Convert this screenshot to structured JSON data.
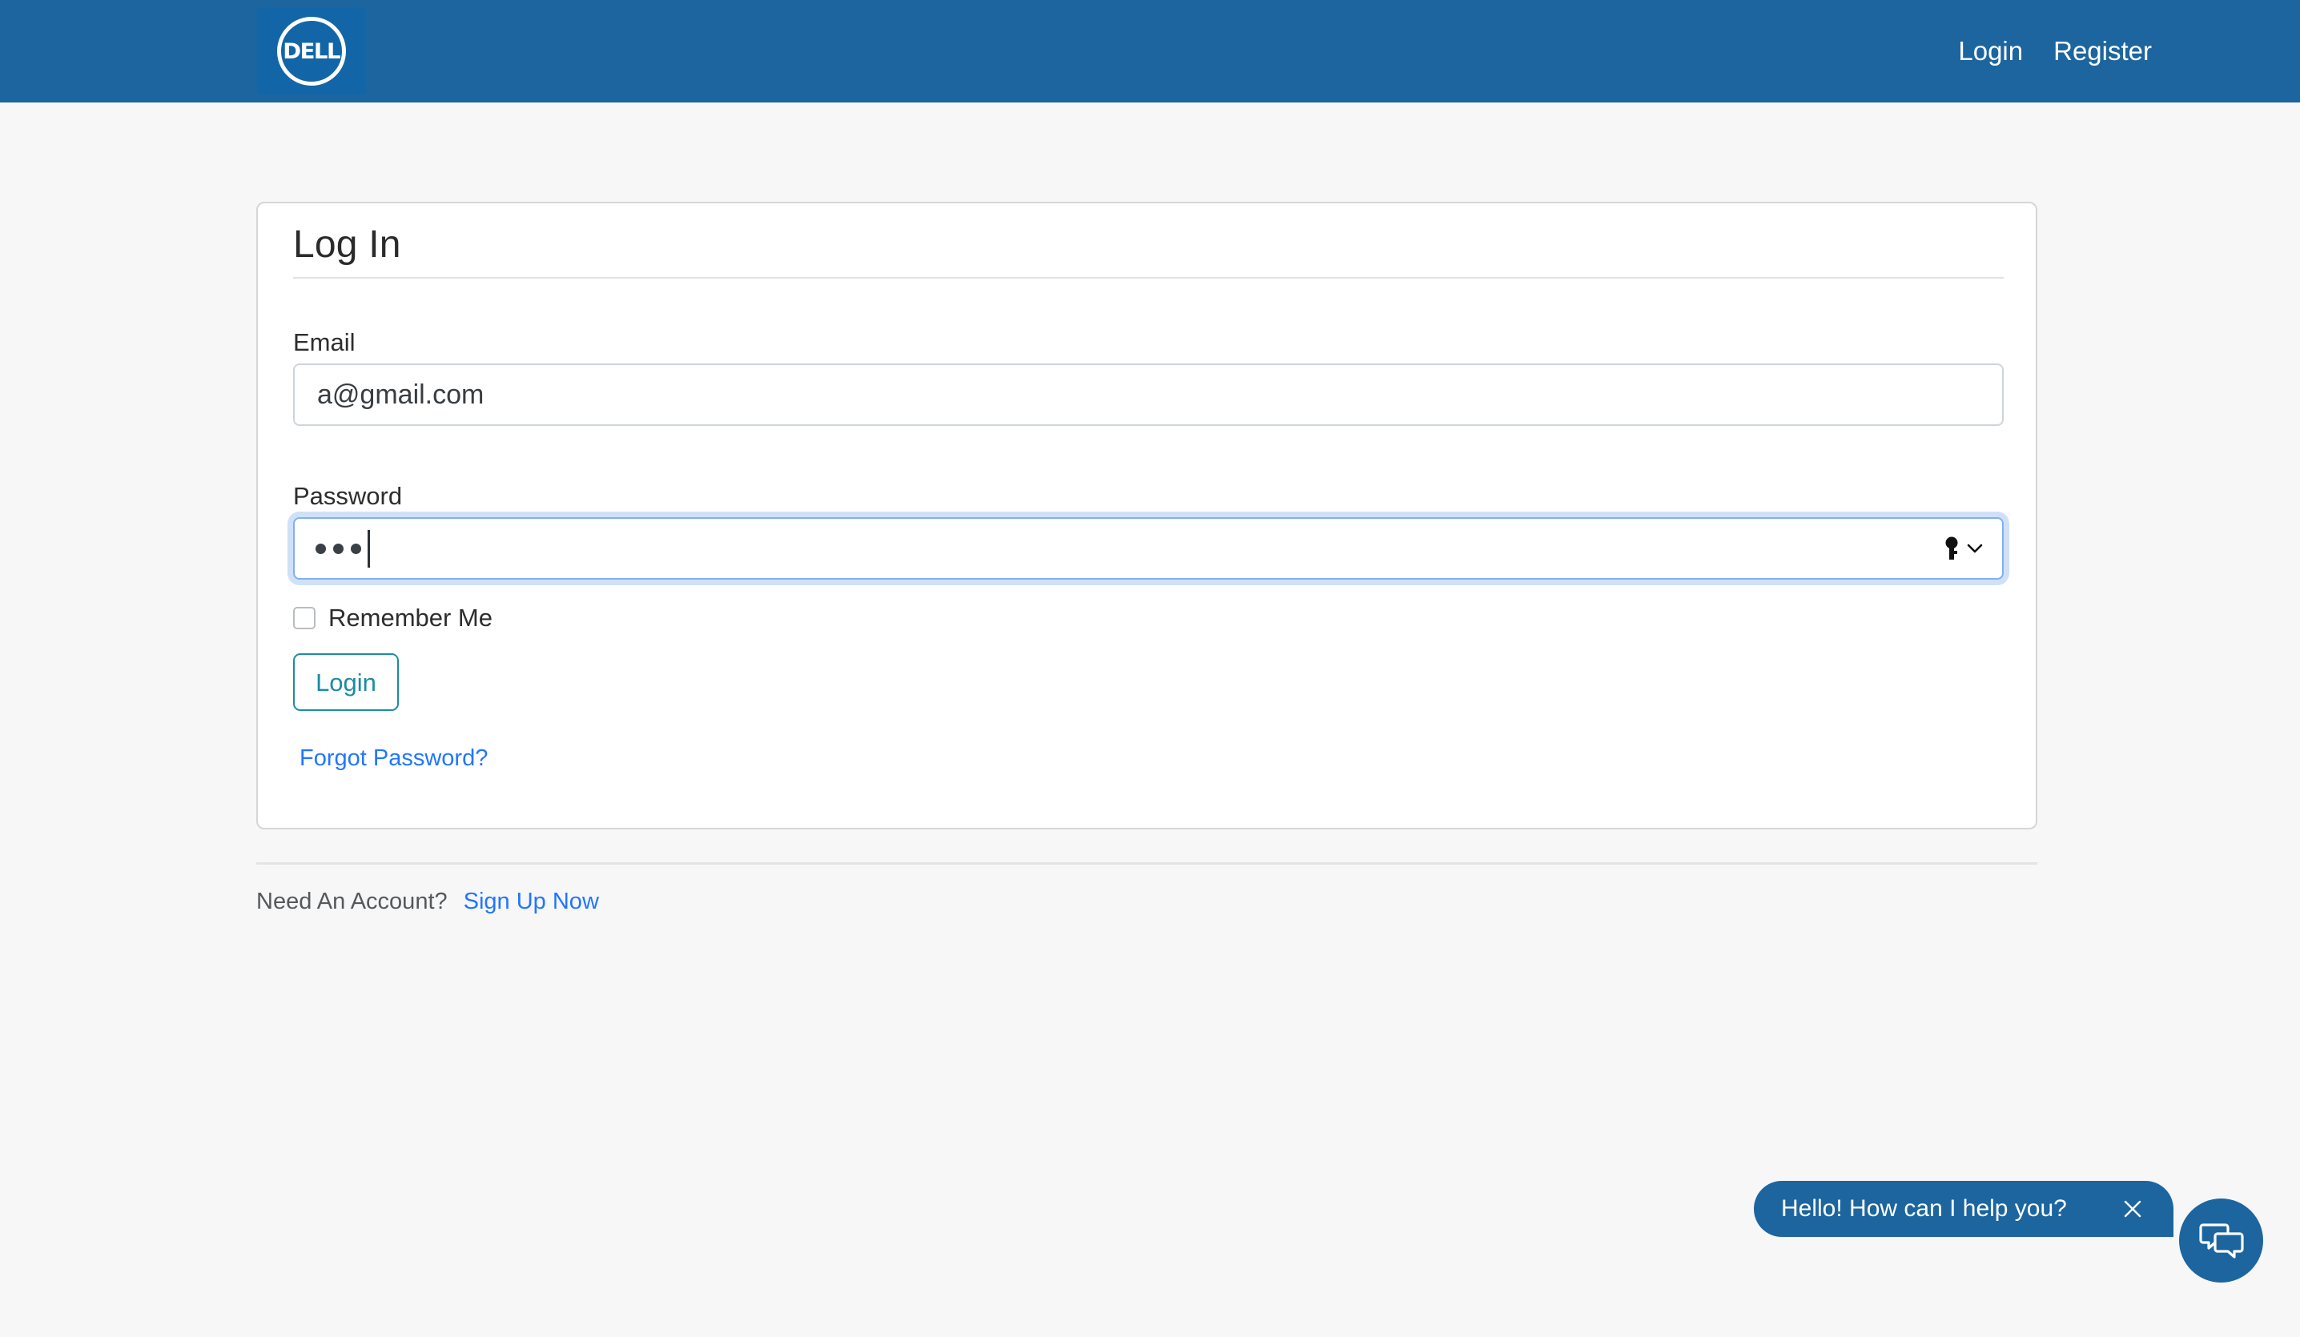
{
  "header": {
    "logo_alt": "Dell",
    "logo_text": "DELL",
    "nav": [
      {
        "label": "Login",
        "name": "nav-link-login"
      },
      {
        "label": "Register",
        "name": "nav-link-register"
      }
    ]
  },
  "card": {
    "title": "Log In",
    "email": {
      "label": "Email",
      "value": "a@gmail.com",
      "placeholder": "Email"
    },
    "password": {
      "label": "Password",
      "value": "•••",
      "masked_length": 3,
      "placeholder": "Password",
      "focused": true,
      "autofill_icon": "key-icon"
    },
    "remember": {
      "label": "Remember Me",
      "checked": false
    },
    "login_button": "Login",
    "forgot_link": "Forgot Password?"
  },
  "footer": {
    "need_account_text": "Need An Account?",
    "signup_link": "Sign Up Now"
  },
  "chat": {
    "greeting": "Hello! How can I help you?",
    "close_label": "×",
    "fab_icon": "chat-bubbles-icon"
  },
  "colors": {
    "header_blue": "#1c659f",
    "logo_blue": "#1266a8",
    "link_blue": "#2176ff",
    "button_teal": "#1b8ca3",
    "focus_blue": "#80b0f0",
    "page_bg": "#f7f7f8"
  }
}
